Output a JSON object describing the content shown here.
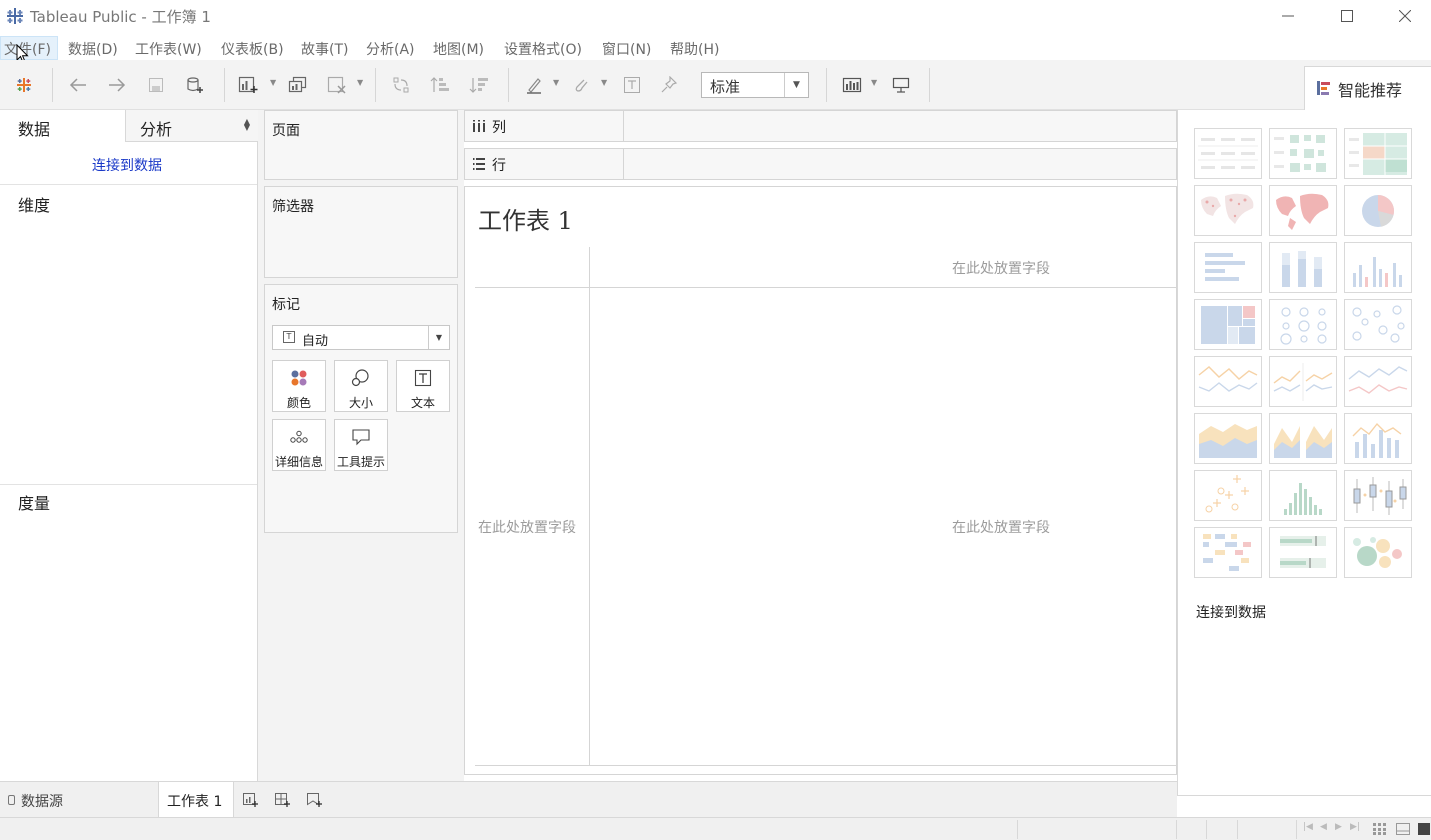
{
  "window": {
    "title": "Tableau Public - 工作簿 1",
    "buttons": [
      "minimize",
      "maximize",
      "close"
    ]
  },
  "menu": {
    "items": [
      {
        "label": "文件(F)"
      },
      {
        "label": "数据(D)"
      },
      {
        "label": "工作表(W)"
      },
      {
        "label": "仪表板(B)"
      },
      {
        "label": "故事(T)"
      },
      {
        "label": "分析(A)"
      },
      {
        "label": "地图(M)"
      },
      {
        "label": "设置格式(O)"
      },
      {
        "label": "窗口(N)"
      },
      {
        "label": "帮助(H)"
      }
    ]
  },
  "toolbar": {
    "fit_value": "标准",
    "show_me_label": "智能推荐",
    "icons": [
      "tableau-logo-icon",
      "undo-icon",
      "redo-icon",
      "save-icon",
      "new-datasource-icon",
      "new-worksheet-icon",
      "duplicate-icon",
      "clear-icon",
      "swap-icon",
      "sort-ascending-icon",
      "sort-descending-icon",
      "highlight-icon",
      "group-icon",
      "labels-icon",
      "pin-icon",
      "show-cards-icon",
      "presentation-icon"
    ]
  },
  "data_pane": {
    "tab_data": "数据",
    "tab_analysis": "分析",
    "connect_link": "连接到数据",
    "dimensions": "维度",
    "measures": "度量"
  },
  "shelves": {
    "pages": "页面",
    "filters": "筛选器",
    "marks": "标记",
    "marks_type": "自动",
    "mark_buttons": [
      {
        "label": "颜色",
        "icon": "color-icon"
      },
      {
        "label": "大小",
        "icon": "size-icon"
      },
      {
        "label": "文本",
        "icon": "text-icon"
      },
      {
        "label": "详细信息",
        "icon": "detail-icon"
      },
      {
        "label": "工具提示",
        "icon": "tooltip-icon"
      }
    ],
    "columns": "列",
    "rows": "行"
  },
  "view": {
    "sheet_title": "工作表 1",
    "drop_hint_columns": "在此处放置字段",
    "drop_hint_rows": "在此处放置字段",
    "drop_hint_center": "在此处放置字段"
  },
  "show_me": {
    "connect_label": "连接到数据",
    "charts": [
      "text-table",
      "heat-map",
      "highlight-table",
      "symbol-map",
      "filled-map",
      "pie-chart",
      "horizontal-bars",
      "stacked-bars",
      "side-by-side-bars",
      "treemap",
      "circle-view",
      "side-by-side-circles",
      "continuous-lines",
      "discrete-lines",
      "dual-lines",
      "area-continuous",
      "area-discrete",
      "dual-combination",
      "scatter-plot",
      "histogram",
      "box-and-whisker",
      "gantt-chart",
      "bullet-graph",
      "packed-bubbles"
    ]
  },
  "tabs": {
    "datasource": "数据源",
    "sheet": "工作表 1"
  },
  "colors": {
    "link_blue": "#1a39c8",
    "menu_highlight": "#e5f1fb",
    "hint_gray": "#9c9c9c"
  }
}
